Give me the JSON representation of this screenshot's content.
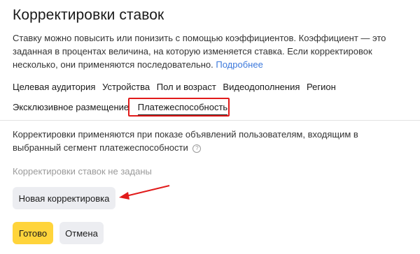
{
  "title": "Корректировки ставок",
  "description": {
    "text": "Ставку можно повысить или понизить с помощью коэффициентов. Коэффициент — это заданная в процентах величина, на которую изменяется ставка. Если корректировок несколько, они применяются последовательно.",
    "link": "Подробнее"
  },
  "tabs": {
    "row1": [
      "Целевая аудитория",
      "Устройства",
      "Пол и возраст",
      "Видеодополнения",
      "Регион"
    ],
    "row2": [
      "Эксклюзивное размещение"
    ],
    "active": "Платежеспособность"
  },
  "info": {
    "text": "Корректировки применяются при показе объявлений пользователям, входящим в выбранный сегмент платежеспособности",
    "help_icon": "question-circle-icon"
  },
  "empty_note": "Корректировки ставок не заданы",
  "buttons": {
    "new_adjustment": "Новая корректировка",
    "ok": "Готово",
    "cancel": "Отмена"
  },
  "colors": {
    "accent_yellow": "#ffd43b",
    "highlight_red": "#e11b1b",
    "link_blue": "#3c79dc",
    "button_gray": "#ecedf1"
  }
}
